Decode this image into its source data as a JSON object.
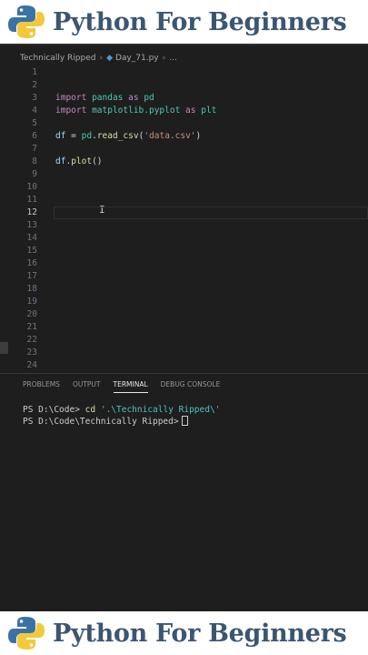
{
  "banner": {
    "title": "Python For Beginners"
  },
  "breadcrumb": {
    "folder": "Technically Ripped",
    "file": "Day_71.py",
    "more": "..."
  },
  "editor": {
    "active_line": 12,
    "lines": [
      {
        "n": "1"
      },
      {
        "n": "2"
      },
      {
        "n": "3",
        "t": [
          {
            "k": "kw",
            "v": "import"
          },
          {
            "k": "",
            "v": " "
          },
          {
            "k": "mod",
            "v": "pandas"
          },
          {
            "k": "",
            "v": " "
          },
          {
            "k": "kw",
            "v": "as"
          },
          {
            "k": "",
            "v": " "
          },
          {
            "k": "mod",
            "v": "pd"
          }
        ]
      },
      {
        "n": "4",
        "t": [
          {
            "k": "kw",
            "v": "import"
          },
          {
            "k": "",
            "v": " "
          },
          {
            "k": "mod",
            "v": "matplotlib.pyplot"
          },
          {
            "k": "",
            "v": " "
          },
          {
            "k": "kw",
            "v": "as"
          },
          {
            "k": "",
            "v": " "
          },
          {
            "k": "mod",
            "v": "plt"
          }
        ]
      },
      {
        "n": "5"
      },
      {
        "n": "6",
        "t": [
          {
            "k": "var",
            "v": "df"
          },
          {
            "k": "",
            "v": " = "
          },
          {
            "k": "mod",
            "v": "pd"
          },
          {
            "k": "",
            "v": "."
          },
          {
            "k": "fn",
            "v": "read_csv"
          },
          {
            "k": "",
            "v": "("
          },
          {
            "k": "str",
            "v": "'data.csv'"
          },
          {
            "k": "",
            "v": ")"
          }
        ]
      },
      {
        "n": "7"
      },
      {
        "n": "8",
        "t": [
          {
            "k": "var",
            "v": "df"
          },
          {
            "k": "",
            "v": "."
          },
          {
            "k": "fn",
            "v": "plot"
          },
          {
            "k": "",
            "v": "()"
          }
        ]
      },
      {
        "n": "9"
      },
      {
        "n": "10"
      },
      {
        "n": "11"
      },
      {
        "n": "12"
      },
      {
        "n": "13"
      },
      {
        "n": "14"
      },
      {
        "n": "15"
      },
      {
        "n": "16"
      },
      {
        "n": "17"
      },
      {
        "n": "18"
      },
      {
        "n": "19"
      },
      {
        "n": "20"
      },
      {
        "n": "21"
      },
      {
        "n": "22"
      },
      {
        "n": "23"
      },
      {
        "n": "24"
      }
    ]
  },
  "panel": {
    "tabs": [
      "PROBLEMS",
      "OUTPUT",
      "TERMINAL",
      "DEBUG CONSOLE"
    ],
    "active_tab": "TERMINAL",
    "terminal": {
      "line1_prompt": "PS D:\\Code>",
      "line1_cmd": "cd",
      "line1_arg": "'.\\Technically Ripped\\'",
      "line2_prompt": "PS D:\\Code\\Technically Ripped>"
    }
  },
  "colors": {
    "banner_text": "#3b5673",
    "python_blue": "#3b72a5",
    "python_yellow": "#f3c93c",
    "editor_bg": "#1e1e1e"
  }
}
